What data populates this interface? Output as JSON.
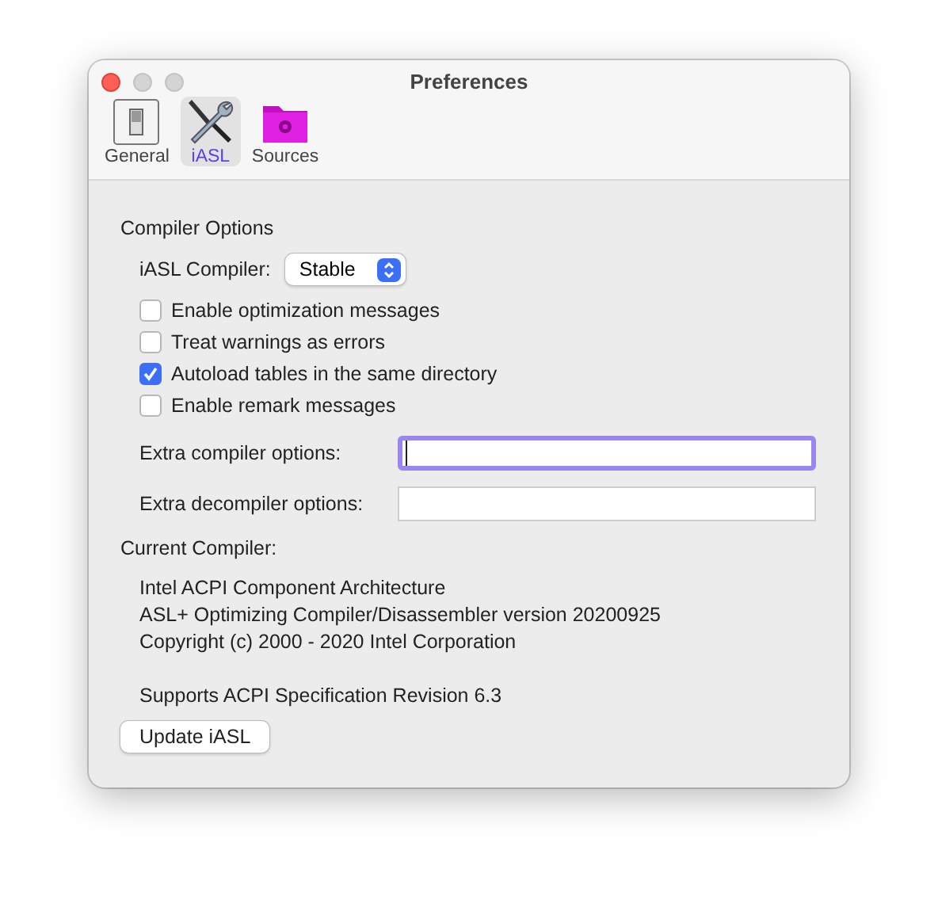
{
  "window": {
    "title": "Preferences"
  },
  "tabs": [
    {
      "label": "General",
      "kind": "switch",
      "selected": false
    },
    {
      "label": "iASL",
      "kind": "tools",
      "selected": true
    },
    {
      "label": "Sources",
      "kind": "folder",
      "selected": false
    }
  ],
  "compiler_options": {
    "heading": "Compiler Options",
    "compiler_label": "iASL Compiler:",
    "compiler_value": "Stable",
    "checkboxes": [
      {
        "label": "Enable optimization messages",
        "checked": false
      },
      {
        "label": "Treat warnings as errors",
        "checked": false
      },
      {
        "label": "Autoload tables in the same directory",
        "checked": true
      },
      {
        "label": "Enable remark messages",
        "checked": false
      }
    ],
    "fields": [
      {
        "label": "Extra compiler options:",
        "focused": true
      },
      {
        "label": "Extra decompiler options:",
        "focused": false
      }
    ]
  },
  "current_compiler": {
    "heading": "Current Compiler:",
    "info_lines": [
      "Intel ACPI Component Architecture",
      "ASL+ Optimizing Compiler/Disassembler version 20200925",
      "Copyright (c) 2000 - 2020 Intel Corporation"
    ],
    "support": "Supports ACPI Specification Revision 6.3"
  },
  "buttons": [
    "Update iASL"
  ]
}
